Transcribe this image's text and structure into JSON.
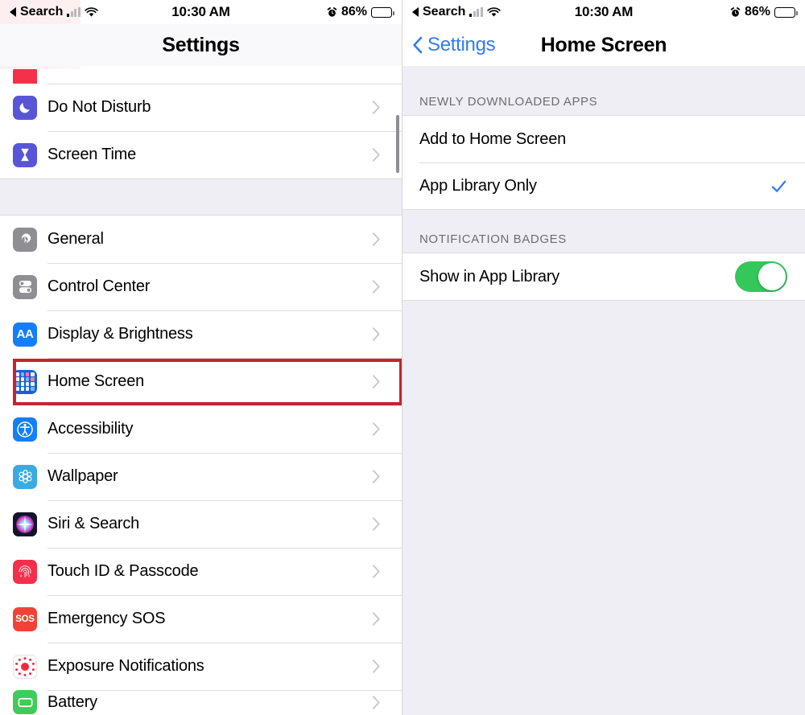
{
  "status_bar": {
    "carrier_back_label": "Search",
    "time": "10:30 AM",
    "battery_percent": "86%",
    "signal_icon": "signal-bars-icon",
    "wifi_icon": "wifi-icon",
    "alarm_icon": "alarm-clock-icon",
    "battery_icon": "battery-icon",
    "back_triangle_icon": "back-triangle-icon"
  },
  "left_panel": {
    "nav": {
      "title": "Settings"
    },
    "scroll_indicator": "scroll-indicator",
    "highlight_target": "Home Screen",
    "highlight_color": "#c32430",
    "groups": [
      {
        "items": [
          {
            "label": "",
            "icon": "partial-red-icon",
            "partial": true
          },
          {
            "label": "Do Not Disturb",
            "icon": "moon-icon"
          },
          {
            "label": "Screen Time",
            "icon": "hourglass-icon"
          }
        ]
      },
      {
        "items": [
          {
            "label": "General",
            "icon": "gear-icon"
          },
          {
            "label": "Control Center",
            "icon": "toggles-icon"
          },
          {
            "label": "Display & Brightness",
            "icon": "aa-icon"
          },
          {
            "label": "Home Screen",
            "icon": "home-screen-grid-icon"
          },
          {
            "label": "Accessibility",
            "icon": "accessibility-icon"
          },
          {
            "label": "Wallpaper",
            "icon": "flower-icon"
          },
          {
            "label": "Siri & Search",
            "icon": "siri-icon"
          },
          {
            "label": "Touch ID & Passcode",
            "icon": "fingerprint-icon"
          },
          {
            "label": "Emergency SOS",
            "icon": "sos-icon"
          },
          {
            "label": "Exposure Notifications",
            "icon": "exposure-icon"
          },
          {
            "label": "Battery",
            "icon": "battery-app-icon"
          }
        ]
      }
    ],
    "chevron_icon": "chevron-right-icon"
  },
  "right_panel": {
    "nav": {
      "back_label": "Settings",
      "back_icon": "chevron-left-icon",
      "title": "Home Screen"
    },
    "sections": [
      {
        "header": "NEWLY DOWNLOADED APPS",
        "rows": [
          {
            "label": "Add to Home Screen",
            "selected": false
          },
          {
            "label": "App Library Only",
            "selected": true,
            "check_icon": "checkmark-icon"
          }
        ]
      },
      {
        "header": "NOTIFICATION BADGES",
        "rows": [
          {
            "label": "Show in App Library",
            "toggle": true,
            "toggle_on": true
          }
        ]
      }
    ],
    "accent_color": "#2f7cf6",
    "toggle_on_color": "#34c759",
    "check_color": "#2f7cf6"
  }
}
